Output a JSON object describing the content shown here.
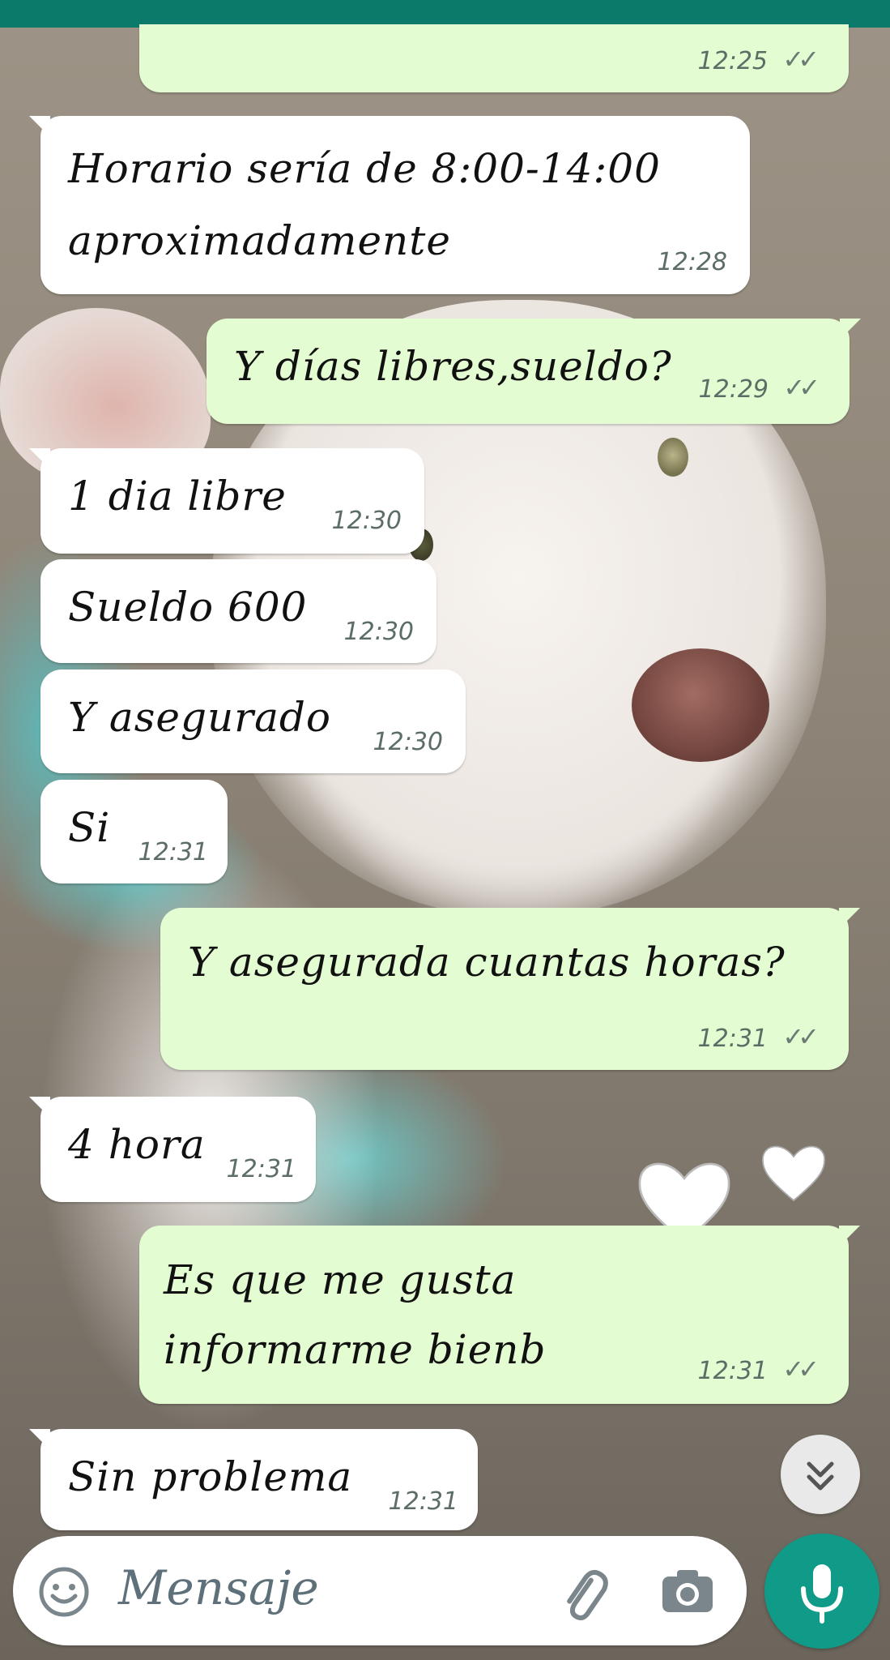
{
  "colors": {
    "header": "#0b7a6b",
    "incoming_bubble": "#ffffff",
    "outgoing_bubble": "#e3fcd2",
    "mic_button": "#0f9b88",
    "timestamp": "#5c6d66"
  },
  "messages": [
    {
      "direction": "out",
      "lines": [],
      "time": "12:25",
      "status": "read-ticks"
    },
    {
      "direction": "in",
      "lines": [
        "Horario sería de 8:00-14:00",
        "aproximadamente"
      ],
      "time": "12:28"
    },
    {
      "direction": "out",
      "lines": [
        "Y días libres,sueldo?"
      ],
      "time": "12:29",
      "status": "read-ticks"
    },
    {
      "direction": "in",
      "lines": [
        "1 dia libre"
      ],
      "time": "12:30"
    },
    {
      "direction": "in",
      "lines": [
        "Sueldo 600"
      ],
      "time": "12:30"
    },
    {
      "direction": "in",
      "lines": [
        "Y asegurado"
      ],
      "time": "12:30"
    },
    {
      "direction": "in",
      "lines": [
        "Si"
      ],
      "time": "12:31"
    },
    {
      "direction": "out",
      "lines": [
        "Y asegurada cuantas horas?"
      ],
      "time": "12:31",
      "status": "read-ticks"
    },
    {
      "direction": "in",
      "lines": [
        "4 hora"
      ],
      "time": "12:31"
    },
    {
      "direction": "out",
      "lines": [
        "Es que me gusta",
        "informarme bienb"
      ],
      "time": "12:31",
      "status": "read-ticks"
    },
    {
      "direction": "in",
      "lines": [
        "Sin problema"
      ],
      "time": "12:31"
    }
  ],
  "composer": {
    "placeholder": "Mensaje",
    "emoji_icon": "emoji-icon",
    "attach_icon": "paperclip-icon",
    "camera_icon": "camera-icon",
    "mic_icon": "microphone-icon"
  },
  "scroll_button_icon": "double-chevron-down-icon",
  "wallpaper": "photo of a white puppy wearing a teal harness"
}
